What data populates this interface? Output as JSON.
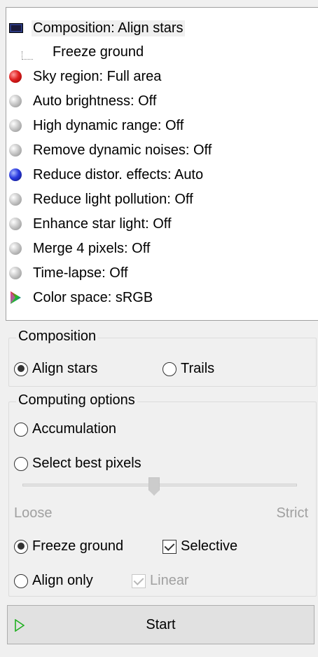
{
  "tree": {
    "items": [
      {
        "label": "Composition: Align stars",
        "icon": "screen-icon"
      },
      {
        "label": "Freeze ground",
        "icon": "tree-connector"
      },
      {
        "label": "Sky region: Full area",
        "icon": "red-ball-icon"
      },
      {
        "label": "Auto brightness: Off",
        "icon": "gray-ball-icon"
      },
      {
        "label": "High dynamic range: Off",
        "icon": "gray-ball-icon"
      },
      {
        "label": "Remove dynamic noises: Off",
        "icon": "gray-ball-icon"
      },
      {
        "label": "Reduce distor. effects: Auto",
        "icon": "blue-ball-icon"
      },
      {
        "label": "Reduce light pollution: Off",
        "icon": "gray-ball-icon"
      },
      {
        "label": "Enhance star light: Off",
        "icon": "gray-ball-icon"
      },
      {
        "label": "Merge 4 pixels: Off",
        "icon": "gray-ball-icon"
      },
      {
        "label": "Time-lapse: Off",
        "icon": "gray-ball-icon"
      },
      {
        "label": "Color space: sRGB",
        "icon": "color-triangle-icon"
      }
    ]
  },
  "composition": {
    "title": "Composition",
    "align_stars": "Align stars",
    "trails": "Trails",
    "selected": "align_stars"
  },
  "computing": {
    "title": "Computing options",
    "accumulation": "Accumulation",
    "select_best_pixels": "Select best pixels",
    "slider_value": 0.5,
    "loose_label": "Loose",
    "strict_label": "Strict",
    "freeze_ground": "Freeze ground",
    "selective": "Selective",
    "selective_checked": true,
    "align_only": "Align only",
    "linear": "Linear",
    "linear_checked": true,
    "linear_disabled": true
  },
  "start_button": {
    "label": "Start"
  },
  "colors": {
    "background": "#f0f0f0",
    "panel": "#ffffff",
    "start_icon": "#22b022",
    "disabled_text": "#a0a0a0"
  }
}
